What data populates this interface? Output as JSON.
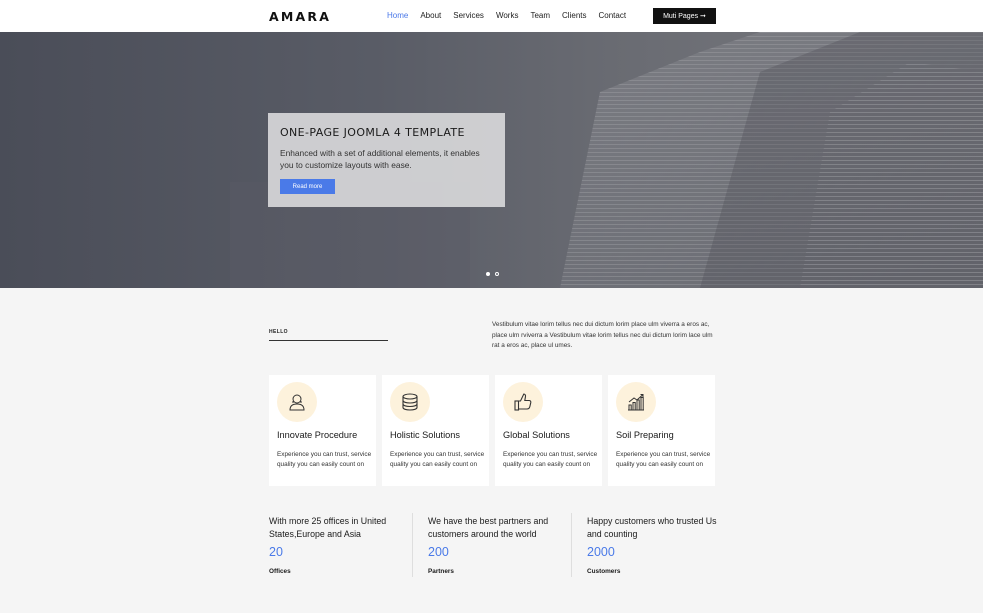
{
  "header": {
    "logo": "AMARA",
    "nav": [
      "Home",
      "About",
      "Services",
      "Works",
      "Team",
      "Clients",
      "Contact"
    ],
    "active_nav": "Home",
    "cta_label": "Muti Pages ➞"
  },
  "hero": {
    "title": "ONE-PAGE JOOMLA 4 TEMPLATE",
    "text": "Enhanced with a set of additional elements, it enables you to customize layouts with ease.",
    "button_label": "Read more",
    "slides": 2,
    "active_slide": 1
  },
  "intro": {
    "kicker": "HELLO",
    "text": "Vestibulum vitae lorim tellus nec dui dictum lorim place ulm viverra a eros ac, place ulm rviverra a Vestibulum vitae lorim tellus nec dui dictum lorim lace ulm rat a eros ac, place ul umes."
  },
  "cards": [
    {
      "icon": "user-icon",
      "title": "Innovate Procedure",
      "text": "Experience you can trust, service quality you can easily count on"
    },
    {
      "icon": "database-icon",
      "title": "Holistic Solutions",
      "text": "Experience you can trust, service quality you can easily count on"
    },
    {
      "icon": "thumbs-up-icon",
      "title": "Global Solutions",
      "text": "Experience you can trust, service quality you can easily count on"
    },
    {
      "icon": "bar-chart-icon",
      "title": "Soil Preparing",
      "text": "Experience you can trust, service quality you can easily count on"
    }
  ],
  "stats": [
    {
      "text": "With more 25 offices in United States,Europe and Asia",
      "number": "20",
      "label": "Offices"
    },
    {
      "text": "We have the best partners and customers around the world",
      "number": "200",
      "label": "Partners"
    },
    {
      "text": "Happy customers who trusted Us and counting",
      "number": "2000",
      "label": "Customers"
    }
  ],
  "colors": {
    "accent": "#4a7ae8",
    "dark": "#111111",
    "icon_bg": "#fdf2dc"
  }
}
